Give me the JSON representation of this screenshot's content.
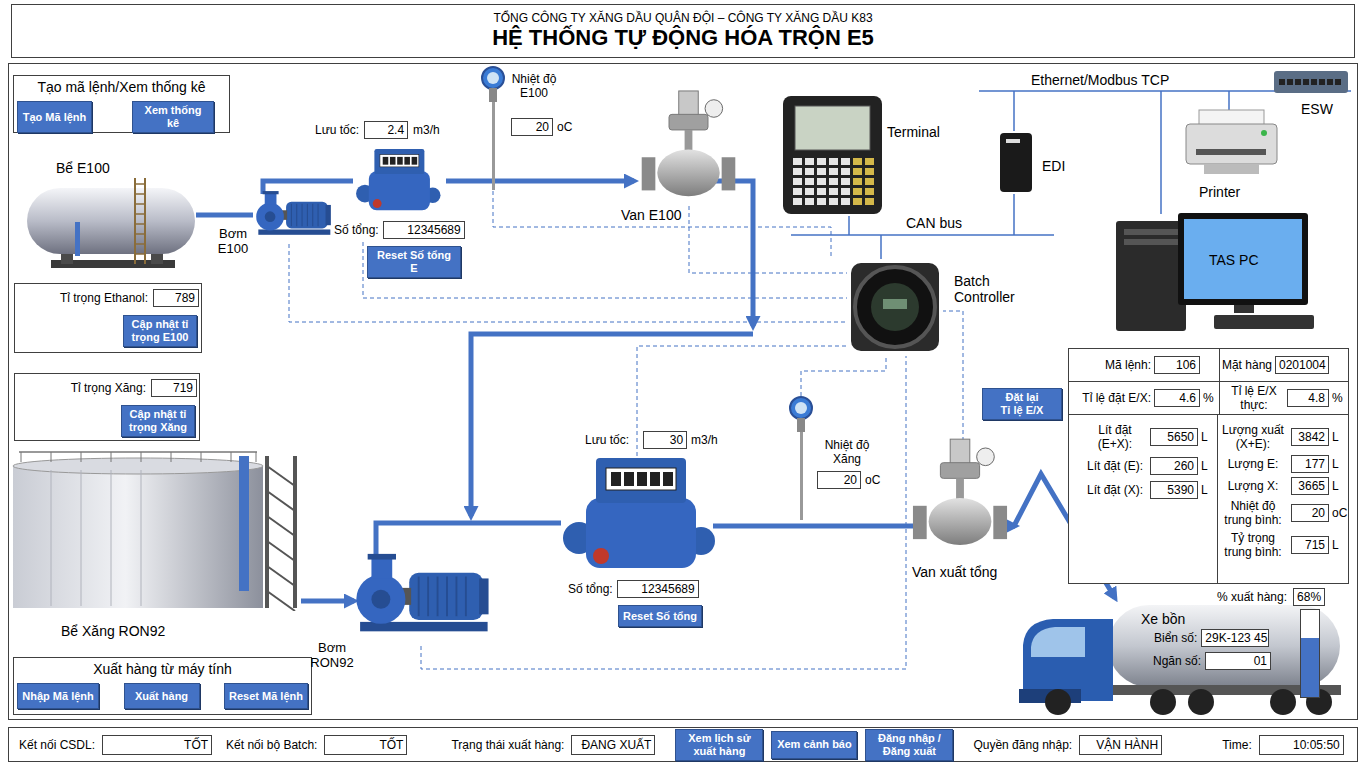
{
  "header": {
    "company": "TỔNG CÔNG TY XĂNG DẦU QUÂN ĐỘI – CÔNG TY XĂNG DẦU K83",
    "title": "HỆ THỐNG TỰ ĐỘNG HÓA TRỘN E5"
  },
  "order_panel": {
    "title": "Tạo mã lệnh/Xem thống kê",
    "buttons": [
      "Tạo Mã lệnh",
      "Xem thống kê"
    ]
  },
  "tanks": [
    {
      "label": "Bể E100"
    },
    {
      "label": "Bể Xăng RON92"
    }
  ],
  "densities": [
    {
      "label": "Tỉ trọng Ethanol:",
      "value": "789",
      "button": "Cập nhật tỉ trọng E100"
    },
    {
      "label": "Tỉ trọng Xăng:",
      "value": "719",
      "button": "Cập nhật tỉ trọng Xăng"
    }
  ],
  "pumps": [
    {
      "label": "Bơm E100"
    },
    {
      "label": "Bơm RON92"
    }
  ],
  "meters": [
    {
      "flow_label": "Lưu tốc:",
      "flow": "2.4",
      "flow_unit": "m3/h",
      "total_label": "Số tổng:",
      "total": "12345689",
      "reset": "Reset Số tổng E"
    },
    {
      "flow_label": "Lưu tốc:",
      "flow": "30",
      "flow_unit": "m3/h",
      "total_label": "Số tổng:",
      "total": "12345689",
      "reset": "Reset Số tổng"
    }
  ],
  "temperatures": [
    {
      "label": "Nhiệt độ E100",
      "value": "20",
      "unit": "oC"
    },
    {
      "label": "Nhiệt độ Xăng",
      "value": "20",
      "unit": "oC"
    }
  ],
  "valves": [
    {
      "label": "Van E100"
    },
    {
      "label": "Van xuất tổng"
    }
  ],
  "network": {
    "ethernet": "Ethernet/Modbus TCP",
    "switch": "ESW",
    "printer": "Printer",
    "pc": "TAS PC",
    "edi": "EDI",
    "terminal": "Terminal",
    "can_bus": "CAN bus",
    "batch_controller": "Batch Controller"
  },
  "order_info": {
    "reset_button_lines": [
      "Đặt lại",
      "Tỉ lệ E/X"
    ],
    "top_rows": [
      [
        {
          "label": "Mã lệnh:",
          "value": "106"
        },
        {
          "label": "Mặt hàng",
          "value": "0201004"
        }
      ],
      [
        {
          "label": "Tỉ lệ đặt E/X:",
          "value": "4.6",
          "unit": "%"
        },
        {
          "label": "Tỉ lệ E/X thực:",
          "value": "4.8",
          "unit": "%"
        }
      ]
    ],
    "set_fields": [
      {
        "label": "Lít đặt (E+X):",
        "value": "5650",
        "unit": "L"
      },
      {
        "label": "Lít đặt (E):",
        "value": "260",
        "unit": "L"
      },
      {
        "label": "Lít đặt (X):",
        "value": "5390",
        "unit": "L"
      }
    ],
    "delivered_fields": [
      {
        "label": "Lượng xuất (X+E):",
        "value": "3842",
        "unit": "L"
      },
      {
        "label": "Lượng E:",
        "value": "177",
        "unit": "L"
      },
      {
        "label": "Lượng X:",
        "value": "3665",
        "unit": "L"
      },
      {
        "label": "Nhiệt độ trung bình:",
        "value": "20",
        "unit": "oC"
      },
      {
        "label": "Tỷ trọng trung bình:",
        "value": "715",
        "unit": "L"
      }
    ]
  },
  "progress": {
    "label": "% xuất hàng:",
    "reading": "68%",
    "level": 0.68
  },
  "truck": {
    "label": "Xe bồn",
    "plate_label": "Biển số:",
    "plate": "29K-123 45",
    "compartment_label": "Ngăn số:",
    "compartment": "01"
  },
  "export_panel": {
    "title": "Xuất hàng từ máy tính",
    "buttons": [
      "Nhập Mã lệnh",
      "Xuất hàng",
      "Reset Mã lệnh"
    ]
  },
  "status_bar": {
    "fields": [
      {
        "label": "Kết nối CSDL:",
        "value": "TỐT"
      },
      {
        "label": "Kết nối bộ Batch:",
        "value": "TỐT"
      },
      {
        "label": "Trạng thái xuất hàng:",
        "value": "ĐANG XUẤT"
      }
    ],
    "buttons": [
      "Xem lịch sử xuất hàng",
      "Xem cảnh báo",
      "Đăng nhập /Đăng xuất"
    ],
    "role": {
      "label": "Quyền đăng nhập:",
      "value": "VẬN HÀNH"
    },
    "time": {
      "label": "Time:",
      "value": "10:05:50"
    }
  }
}
